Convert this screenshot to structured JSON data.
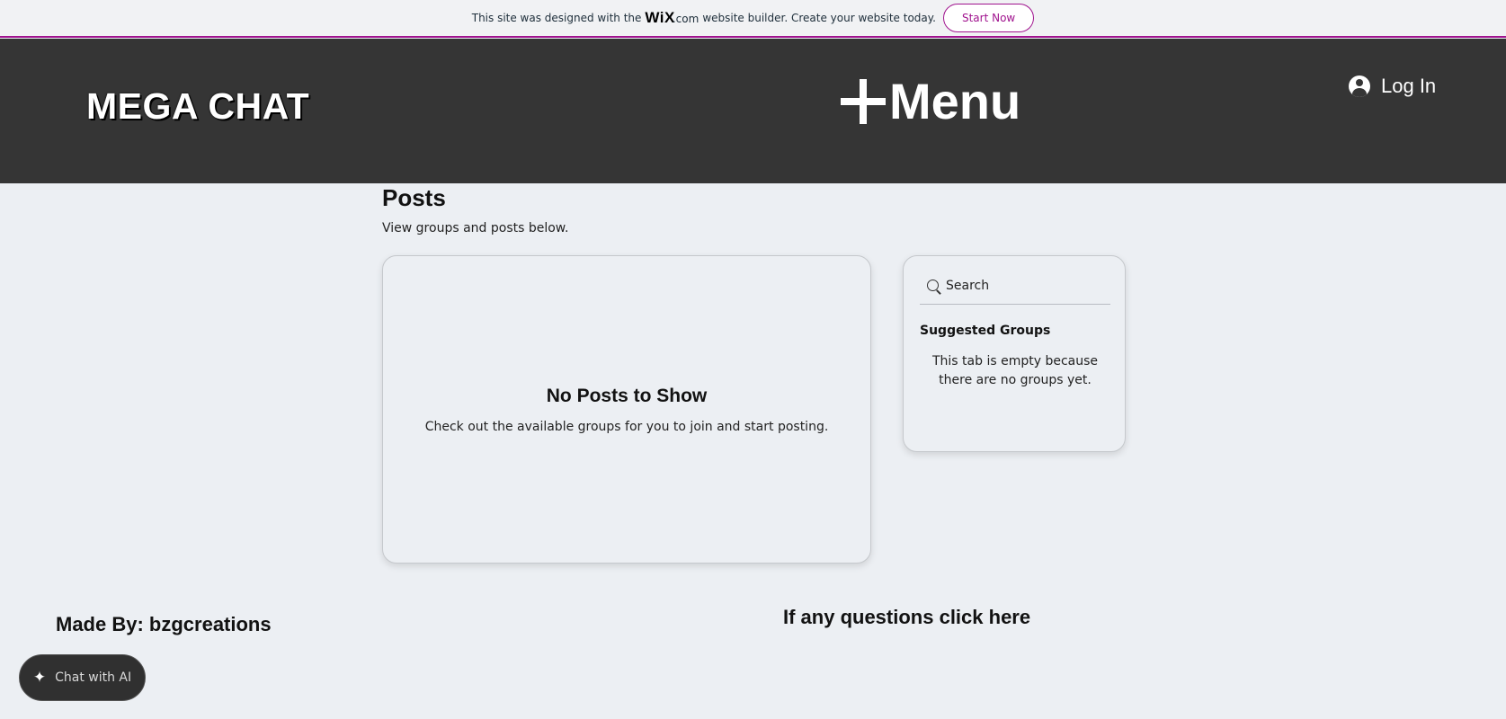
{
  "banner": {
    "text_before": "This site was designed with the",
    "logo": "WiX",
    "logo_suffix": ".com",
    "text_after": "website builder. Create your website today.",
    "cta_label": "Start Now"
  },
  "header": {
    "brand": "MEGA CHAT",
    "menu_label": "Menu",
    "login_label": "Log In"
  },
  "main": {
    "title": "Posts",
    "subtitle": "View groups and posts below.",
    "empty_title": "No Posts to Show",
    "empty_text": "Check out the available groups for you to join and start posting."
  },
  "sidebar": {
    "search_placeholder": "Search",
    "groups_title": "Suggested Groups",
    "groups_empty": "This tab is empty because there are no groups yet."
  },
  "footer": {
    "made_by": "Made By: bzgcreations",
    "questions": "If any questions click here",
    "chat_ai": "Chat with AI"
  },
  "colors": {
    "header_bg": "#353535",
    "page_bg": "#eceff3",
    "wix_accent": "#a0138e"
  },
  "icons": [
    "plus-icon",
    "user-icon",
    "search-icon",
    "sparkle-icon"
  ]
}
